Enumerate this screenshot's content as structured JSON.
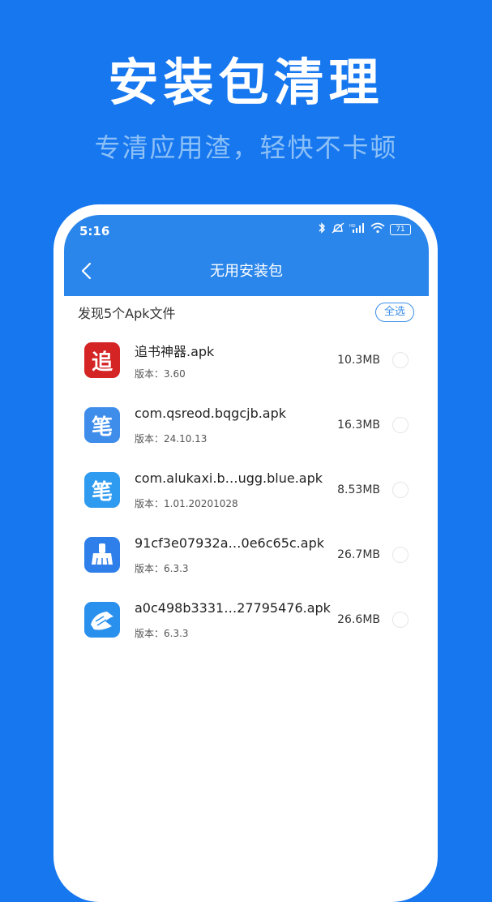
{
  "hero": {
    "title": "安装包清理",
    "subtitle": "专清应用渣，轻快不卡顿"
  },
  "status_bar": {
    "time": "5:16",
    "battery": "71",
    "icons": [
      "bluetooth-icon",
      "mute-icon",
      "signal-icon",
      "wifi-icon",
      "battery-icon"
    ]
  },
  "toolbar": {
    "title": "无用安装包"
  },
  "list_header": {
    "found_text": "发现5个Apk文件",
    "select_all_label": "全选"
  },
  "apk_list": [
    {
      "name": "追书神器.apk",
      "version": "版本：3.60",
      "size": "10.3MB",
      "icon": "red-zhui-app-icon",
      "icon_color": "#D42424",
      "icon_glyph": "追"
    },
    {
      "name": "com.qsreod.bqgcjb.apk",
      "version": "版本：24.10.13",
      "size": "16.3MB",
      "icon": "blue-bi-app-icon",
      "icon_color": "#3E8DEB",
      "icon_glyph": "笔"
    },
    {
      "name": "com.alukaxi.b…ugg.blue.apk",
      "version": "版本：1.01.20201028",
      "size": "8.53MB",
      "icon": "blue-bi-app-icon",
      "icon_color": "#2F9BF0",
      "icon_glyph": "笔"
    },
    {
      "name": "91cf3e07932a…0e6c65c.apk",
      "version": "版本：6.3.3",
      "size": "26.7MB",
      "icon": "broom-app-icon",
      "icon_color": "#2E7FEA",
      "icon_glyph": ""
    },
    {
      "name": "a0c498b3331…27795476.apk",
      "version": "版本：6.3.3",
      "size": "26.6MB",
      "icon": "cleaner-hand-app-icon",
      "icon_color": "#2A90EE",
      "icon_glyph": ""
    }
  ]
}
